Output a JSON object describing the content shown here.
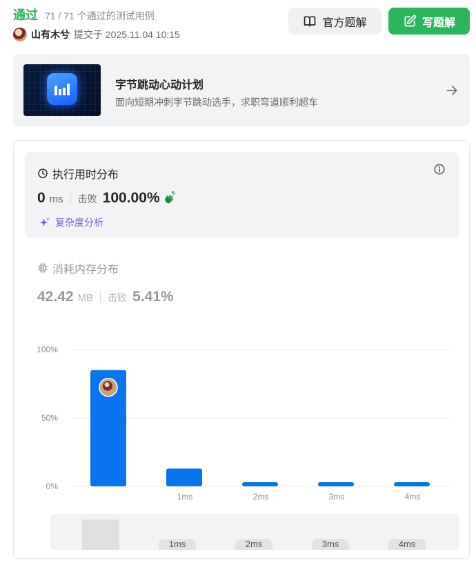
{
  "header": {
    "status": "通过",
    "tests": "71 / 71 个通过的测试用例",
    "author": "山有木兮",
    "submitted": "提交于 2025.11.04 10:15",
    "official_solution": "官方题解",
    "write_solution": "写题解"
  },
  "promo": {
    "title": "字节跳动心动计划",
    "subtitle": "面向短期冲刺字节跳动选手，求职弯道顺利超车"
  },
  "runtime": {
    "title": "执行用时分布",
    "value": "0",
    "unit": "ms",
    "beat_label": "击败",
    "beat_value": "100.00%",
    "complexity": "复杂度分析"
  },
  "memory": {
    "title": "消耗内存分布",
    "value": "42.42",
    "unit": "MB",
    "beat_label": "击败",
    "beat_value": "5.41%"
  },
  "chart_data": {
    "type": "bar",
    "categories": [
      "",
      "1ms",
      "2ms",
      "3ms",
      "4ms"
    ],
    "values": [
      85,
      13,
      3,
      3,
      3
    ],
    "ylim": [
      0,
      100
    ],
    "yticks": [
      "0%",
      "50%",
      "100%"
    ],
    "grid": true,
    "bar_color": "#0a74f0",
    "highlight_index": 0
  },
  "minimap": {
    "labels": [
      "1ms",
      "2ms",
      "3ms",
      "4ms"
    ]
  },
  "colors": {
    "accent_green": "#2db55d",
    "complexity_purple": "#7a63d6",
    "bar_blue": "#0a74f0"
  }
}
